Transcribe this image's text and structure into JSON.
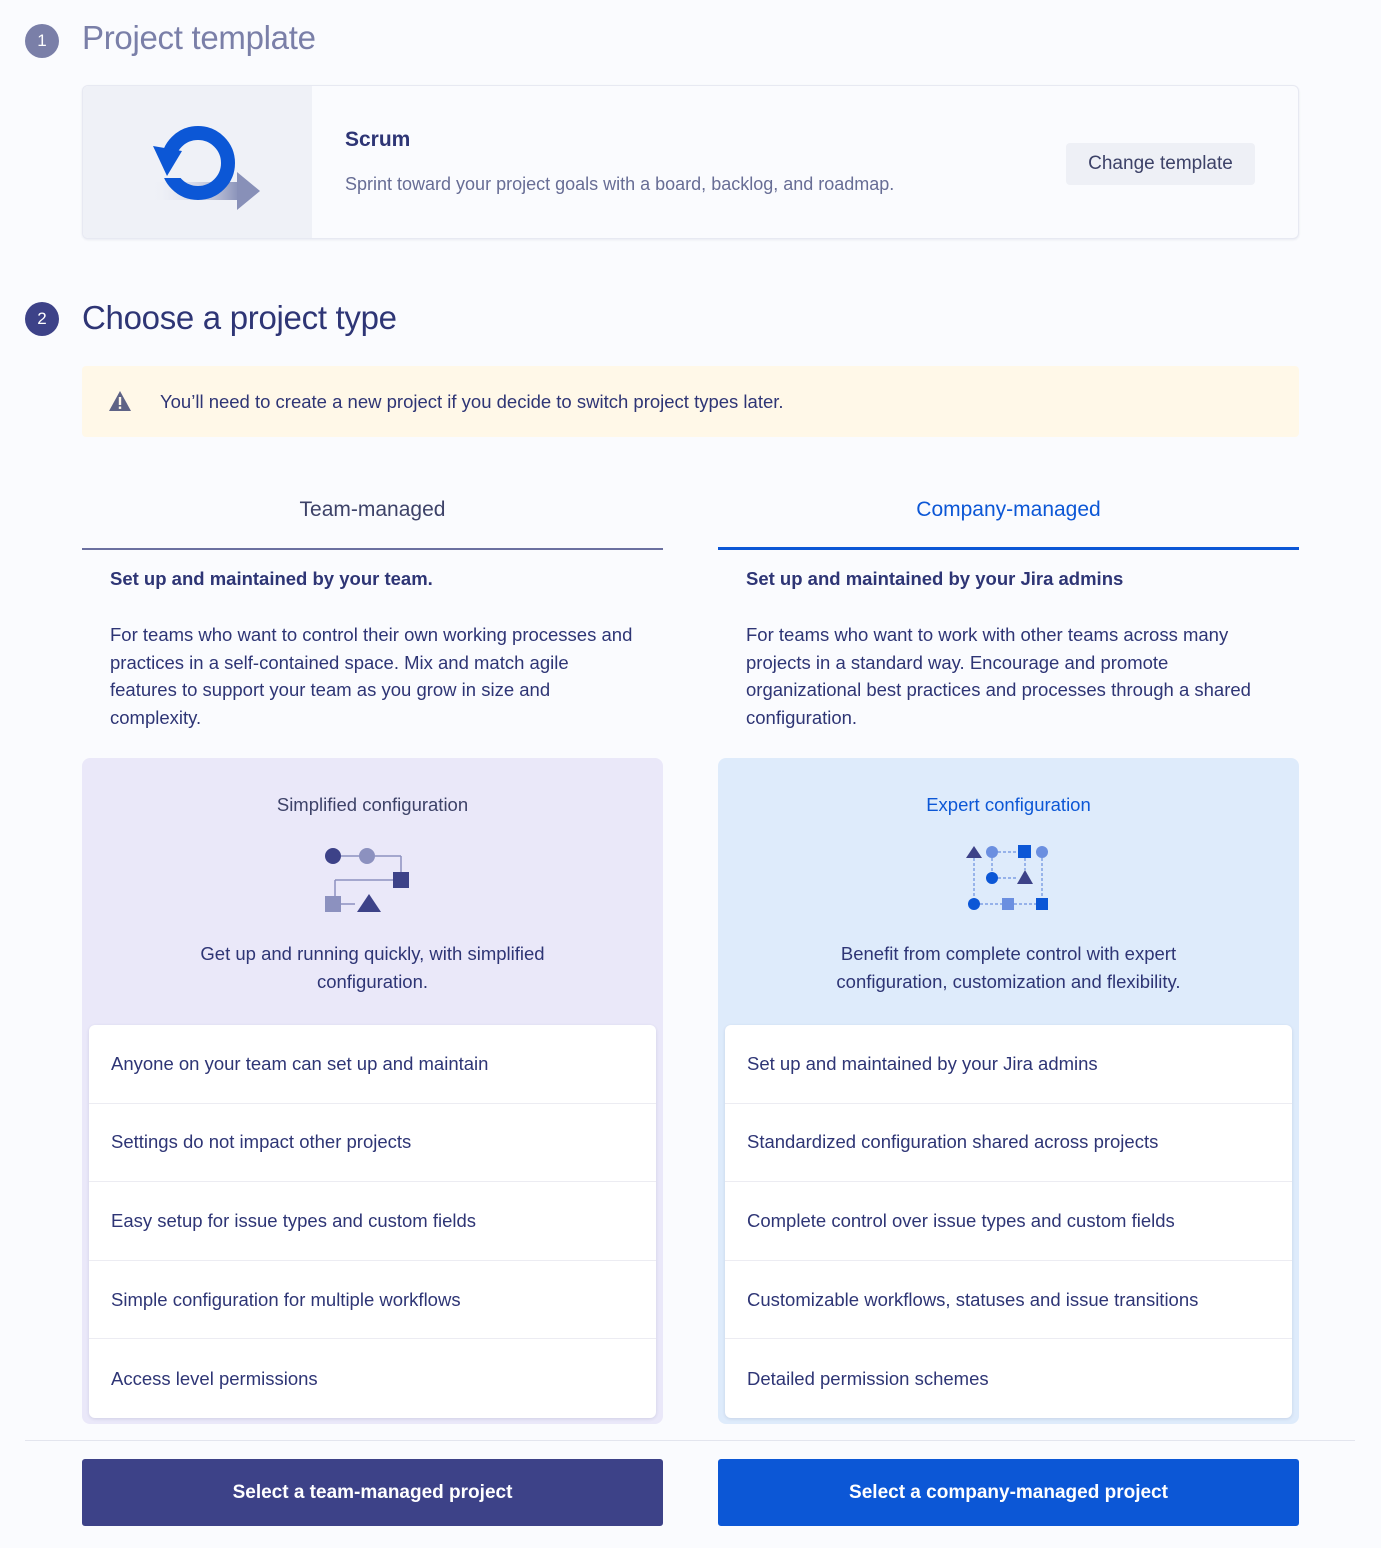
{
  "step1": {
    "number": "1",
    "title": "Project template"
  },
  "template": {
    "name": "Scrum",
    "description": "Sprint toward your project goals with a board, backlog, and roadmap.",
    "change_label": "Change template",
    "icon": "scrum-cycle-icon"
  },
  "step2": {
    "number": "2",
    "title": "Choose a project type"
  },
  "warning": {
    "icon": "warning-triangle-icon",
    "text": "You’ll need to create a new project if you decide to switch project types later."
  },
  "tabs": [
    {
      "label": "Team-managed",
      "selected": false
    },
    {
      "label": "Company-managed",
      "selected": true
    }
  ],
  "team": {
    "heading": "Set up and maintained by your team.",
    "description": "For teams who want to control their own working processes and practices in a self-contained space. Mix and match agile features to support your team as you grow in size and complexity.",
    "config_title": "Simplified configuration",
    "config_body": "Get up and running quickly, with simplified configuration.",
    "features": [
      "Anyone on your team can set up and maintain",
      "Settings do not impact other projects",
      "Easy setup for issue types and custom fields",
      "Simple configuration for multiple workflows",
      "Access level permissions"
    ],
    "cta": "Select a team-managed project"
  },
  "company": {
    "heading": "Set up and maintained by your Jira admins",
    "description": "For teams who want to work with other teams across many projects in a standard way. Encourage and promote organizational best practices and processes through a shared configuration.",
    "config_title": "Expert configuration",
    "config_body": "Benefit from complete control with expert configuration, customization and flexibility.",
    "features": [
      "Set up and maintained by your Jira admins",
      "Standardized configuration shared across projects",
      "Complete control over issue types and custom fields",
      "Customizable workflows, statuses and issue transitions",
      "Detailed permission schemes"
    ],
    "cta": "Select a company-managed project"
  },
  "colors": {
    "team_accent": "#3d4288",
    "company_accent": "#0c57d6",
    "warning_bg": "#fff8e8"
  }
}
